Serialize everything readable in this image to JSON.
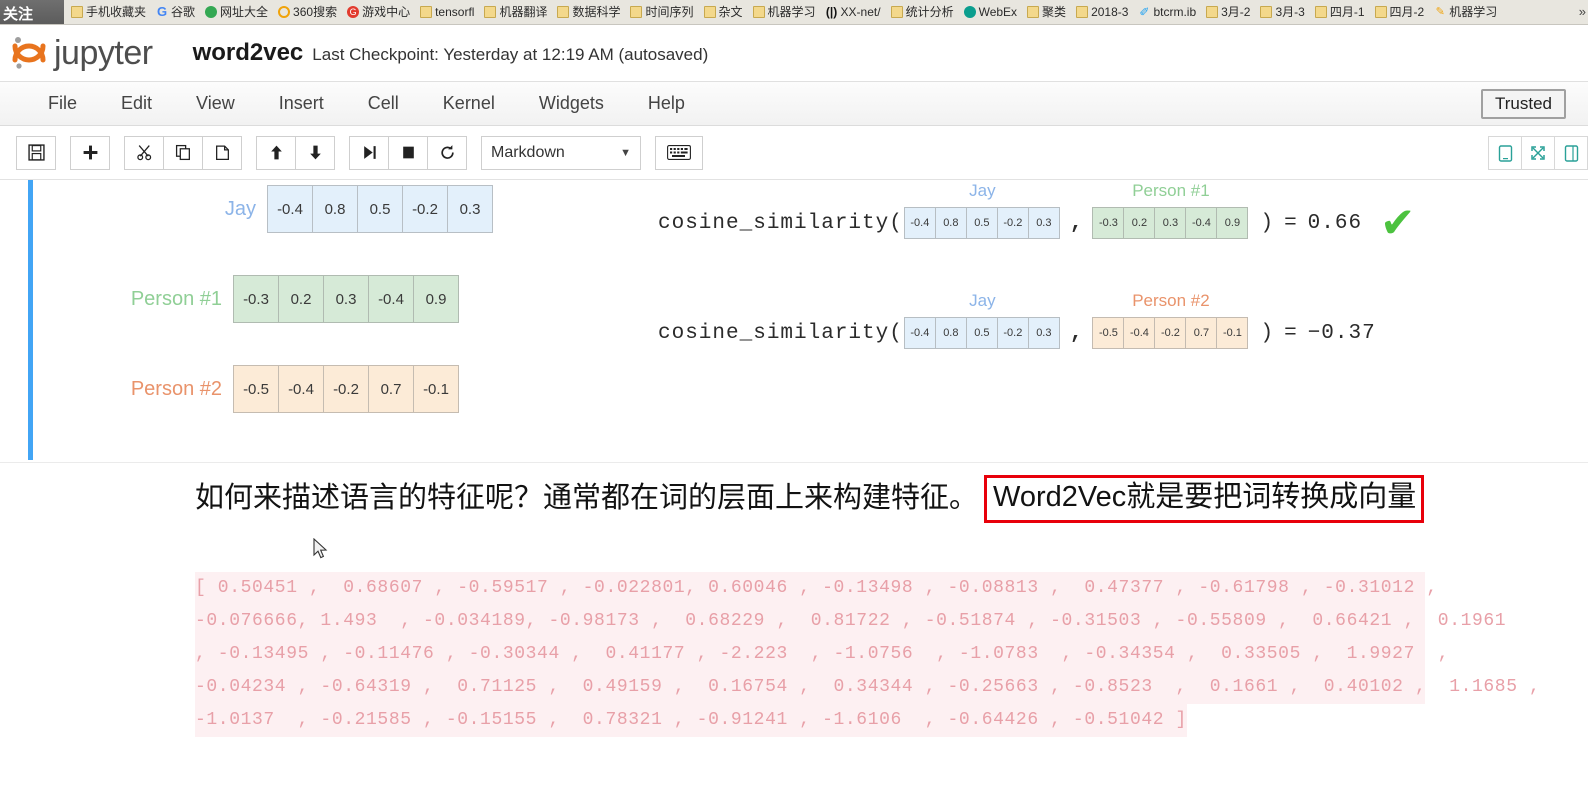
{
  "browser": {
    "bookmarks": [
      {
        "label": "手机收藏夹",
        "icon": "folder-icon"
      },
      {
        "label": "谷歌",
        "icon": "google-g-icon"
      },
      {
        "label": "网址大全",
        "icon": "green-circle-icon"
      },
      {
        "label": "360搜索",
        "icon": "orange-ring-icon"
      },
      {
        "label": "游戏中心",
        "icon": "red-circle-icon"
      },
      {
        "label": "tensorfl",
        "icon": "folder-icon"
      },
      {
        "label": "机器翻译",
        "icon": "folder-icon"
      },
      {
        "label": "数据科学",
        "icon": "folder-icon"
      },
      {
        "label": "时间序列",
        "icon": "folder-icon"
      },
      {
        "label": "杂文",
        "icon": "folder-icon"
      },
      {
        "label": "机器学习",
        "icon": "folder-icon"
      },
      {
        "label": "XX-net/",
        "icon": "dark-bracket-icon"
      },
      {
        "label": "统计分析",
        "icon": "folder-icon"
      },
      {
        "label": "WebEx",
        "icon": "teal-circle-icon"
      },
      {
        "label": "聚类",
        "icon": "folder-icon"
      },
      {
        "label": "2018-3",
        "icon": "folder-icon"
      },
      {
        "label": "btcrm.ib",
        "icon": "blue-bird-icon"
      },
      {
        "label": "3月-2",
        "icon": "folder-icon"
      },
      {
        "label": "3月-3",
        "icon": "folder-icon"
      },
      {
        "label": "四月-1",
        "icon": "folder-icon"
      },
      {
        "label": "四月-2",
        "icon": "folder-icon"
      },
      {
        "label": "机器学习",
        "icon": "pin-icon"
      }
    ],
    "overflow_label": "»",
    "follow_badge": "关注"
  },
  "header": {
    "logo_text": "jupyter",
    "notebook_name": "word2vec",
    "checkpoint": "Last Checkpoint: Yesterday at 12:19 AM (autosaved)"
  },
  "menubar": {
    "items": [
      "File",
      "Edit",
      "View",
      "Insert",
      "Cell",
      "Kernel",
      "Widgets",
      "Help"
    ],
    "trusted_label": "Trusted"
  },
  "toolbar": {
    "save_label": "💾",
    "insert_below_label": "+",
    "cut_label": "✂",
    "copy_label": "⎘",
    "paste_label": "📋",
    "move_up_label": "↑",
    "move_down_label": "↓",
    "run_label": "▶|",
    "stop_label": "■",
    "restart_label": "↻",
    "cell_type_value": "Markdown",
    "cell_type_caret": "▼",
    "keyboard_label": "⌨",
    "right_buttons": [
      "tablet-icon",
      "fullscreen-icon",
      "panel-icon"
    ]
  },
  "notebook": {
    "illustration": {
      "vectors": [
        {
          "label": "Jay",
          "color_class": "jay",
          "values": [
            "-0.4",
            "0.8",
            "0.5",
            "-0.2",
            "0.3"
          ]
        },
        {
          "label": "Person #1",
          "color_class": "p1",
          "values": [
            "-0.3",
            "0.2",
            "0.3",
            "-0.4",
            "0.9"
          ]
        },
        {
          "label": "Person #2",
          "color_class": "p2",
          "values": [
            "-0.5",
            "-0.4",
            "-0.2",
            "0.7",
            "-0.1"
          ]
        }
      ],
      "expressions": [
        {
          "fn": "cosine_similarity(",
          "left_label": "Jay",
          "left_values": [
            "-0.4",
            "0.8",
            "0.5",
            "-0.2",
            "0.3"
          ],
          "separator": ",",
          "right_label": "Person #1",
          "right_values": [
            "-0.3",
            "0.2",
            "0.3",
            "-0.4",
            "0.9"
          ],
          "close": ")",
          "equals": "=",
          "result": "0.66",
          "check": "✔"
        },
        {
          "fn": "cosine_similarity(",
          "left_label": "Jay",
          "left_values": [
            "-0.4",
            "0.8",
            "0.5",
            "-0.2",
            "0.3"
          ],
          "separator": ",",
          "right_label": "Person #2",
          "right_values": [
            "-0.5",
            "-0.4",
            "-0.2",
            "0.7",
            "-0.1"
          ],
          "close": ")",
          "equals": "=",
          "result": "−0.37",
          "check": ""
        }
      ]
    },
    "markdown_text": {
      "plain": "如何来描述语言的特征呢？通常都在词的层面上来构建特征。",
      "highlighted": "Word2Vec就是要把词转换成向量"
    },
    "output_lines": [
      "[ 0.50451 ,  0.68607 , -0.59517 , -0.022801, 0.60046 , -0.13498 , -0.08813 ,  0.47377 , -0.61798 , -0.31012 ,",
      "-0.076666, 1.493  , -0.034189, -0.98173 ,  0.68229 ,  0.81722 , -0.51874 , -0.31503 , -0.55809 ,  0.66421 ,  0.1961",
      ", -0.13495 , -0.11476 , -0.30344 ,  0.41177 , -2.223  , -1.0756  , -1.0783  , -0.34354 ,  0.33505 ,  1.9927  ,",
      "-0.04234 , -0.64319 ,  0.71125 ,  0.49159 ,  0.16754 ,  0.34344 , -0.25663 , -0.8523  ,  0.1661 ,  0.40102 ,  1.1685 ,",
      "-1.0137  , -0.21585 , -0.15155 ,  0.78321 , -0.91241 , -1.6106  , -0.64426 , -0.51042 ]"
    ]
  },
  "colors": {
    "jay_label": "#8cb4e8",
    "person1_label": "#90cf96",
    "person2_label": "#e9936b",
    "highlight_border": "#e8000a",
    "output_text": "#e8a0a8",
    "output_bg": "#fdf0f2",
    "cell_select_bar": "#42a5f5",
    "check_green": "#4cc23f"
  }
}
